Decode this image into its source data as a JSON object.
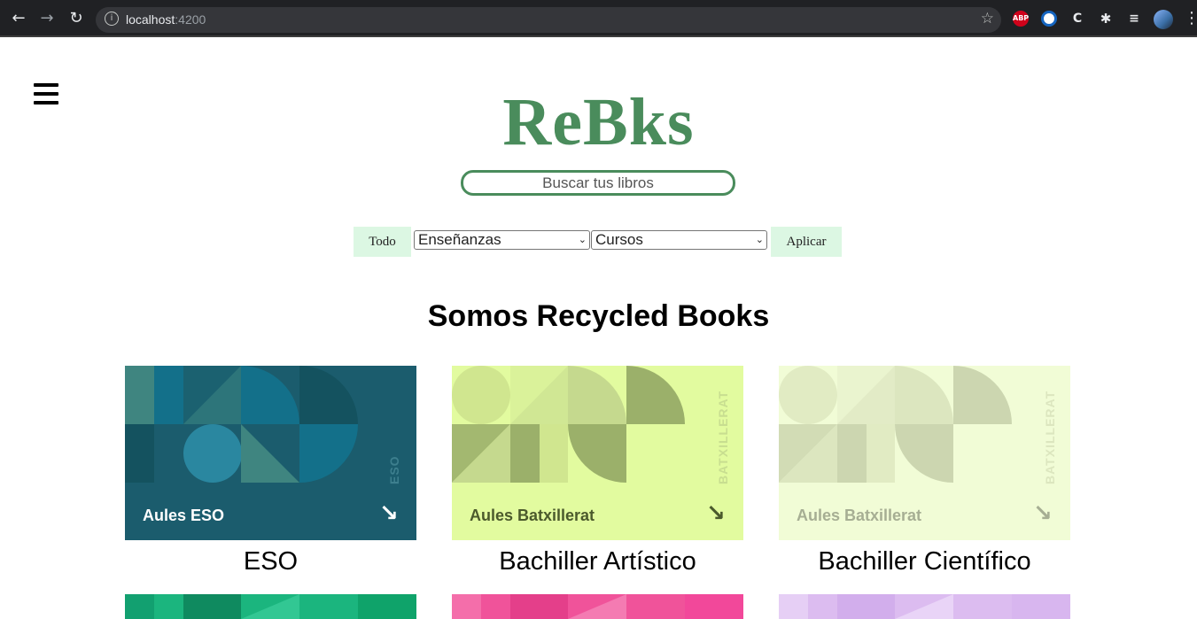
{
  "browser": {
    "url_host": "localhost",
    "url_port": ":4200",
    "extensions": [
      "ABP",
      "shield",
      "C",
      "puzzle",
      "media-list"
    ]
  },
  "header": {
    "logo": "ReBks",
    "search_placeholder": "Buscar tus libros"
  },
  "filters": {
    "todo_label": "Todo",
    "ensenanzas_selected": "Enseñanzas",
    "cursos_selected": "Cursos",
    "apply_label": "Aplicar"
  },
  "main": {
    "heading": "Somos Recycled Books",
    "cards": [
      {
        "title": "Aules ESO",
        "vertical": "ESO",
        "caption": "ESO",
        "bg": "#1b5c6d"
      },
      {
        "title": "Aules Batxillerat",
        "vertical": "BATXILLERAT",
        "caption": "Bachiller Artístico",
        "bg": "#e2fb9f"
      },
      {
        "title": "Aules Batxillerat",
        "vertical": "BATXILLERAT",
        "caption": "Bachiller Científico",
        "bg": "#f1fcd6"
      }
    ],
    "second_row_colors": [
      "#1bb57e",
      "#f0539a",
      "#dcbcf0"
    ]
  },
  "colors": {
    "brand_green": "#4a8c5c",
    "filter_bg": "#dcf7e3"
  }
}
